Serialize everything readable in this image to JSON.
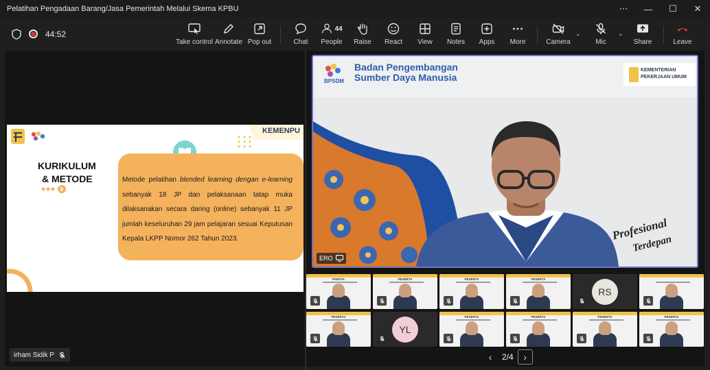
{
  "window": {
    "title": "Pelatihan Pengadaan Barang/Jasa Pemerintah Melalui Skema KPBU",
    "controls": [
      "more",
      "minimize",
      "maximize",
      "close"
    ]
  },
  "meeting": {
    "timer": "44:52",
    "recording": true
  },
  "toolbar": {
    "take_control": "Take control",
    "annotate": "Annotate",
    "pop_out": "Pop out",
    "chat": "Chat",
    "people": "People",
    "people_count": "44",
    "raise": "Raise",
    "react": "React",
    "view": "View",
    "notes": "Notes",
    "apps": "Apps",
    "more": "More",
    "camera": "Camera",
    "mic": "Mic",
    "share": "Share",
    "leave": "Leave"
  },
  "colors": {
    "leave": "#d13438",
    "accent_border": "#6e73c6",
    "slide_orange": "#f4b25d",
    "slide_yellow": "#f6c342"
  },
  "slide": {
    "heading_line1": "KURIKULUM",
    "heading_line2": "& METODE",
    "logo_text": "KEMENPU",
    "body_segments": [
      {
        "t": "Metode pelatihan ",
        "i": false
      },
      {
        "t": "blended learning dengan e-learning",
        "i": true
      },
      {
        "t": " sebanyak 18 JP dan pelaksanaan tatap muka dilaksanakan secara daring (online) sebanyak 11 JP jumlah keseluruhan 29 jam pelajaran sesuai Keputusan Kepala LKPP Nomor 262 Tahun 2023.",
        "i": false
      }
    ]
  },
  "presenter": {
    "name": "irham Sidik P"
  },
  "main_video": {
    "org_line1": "Badan Pengembangan",
    "org_line2": "Sumber Daya Manusia",
    "org_short": "BPSDM",
    "ministry_line1": "KEMENTERIAN",
    "ministry_line2": "PEKERJAAN UMUM",
    "tagline_line1": "Profesional",
    "tagline_line2": "Terdepan",
    "speaker_label": "ERO"
  },
  "tiles_row1": [
    {
      "kind": "video",
      "label": "PANITIA"
    },
    {
      "kind": "video",
      "label": "PESERTA"
    },
    {
      "kind": "video",
      "label": "PESERTA"
    },
    {
      "kind": "video",
      "label": "PESERTA"
    },
    {
      "kind": "avatar",
      "initials": "RS",
      "color": "#e9e6dd"
    },
    {
      "kind": "video",
      "label": ""
    }
  ],
  "tiles_row2": [
    {
      "kind": "video",
      "label": "PESERTA"
    },
    {
      "kind": "avatar",
      "initials": "YL",
      "color": "#f3cdd6"
    },
    {
      "kind": "video",
      "label": "PESERTA"
    },
    {
      "kind": "video",
      "label": "PESERTA"
    },
    {
      "kind": "video",
      "label": "PESERTA"
    },
    {
      "kind": "video",
      "label": "PESERTA"
    }
  ],
  "pager": {
    "text": "2/4"
  }
}
